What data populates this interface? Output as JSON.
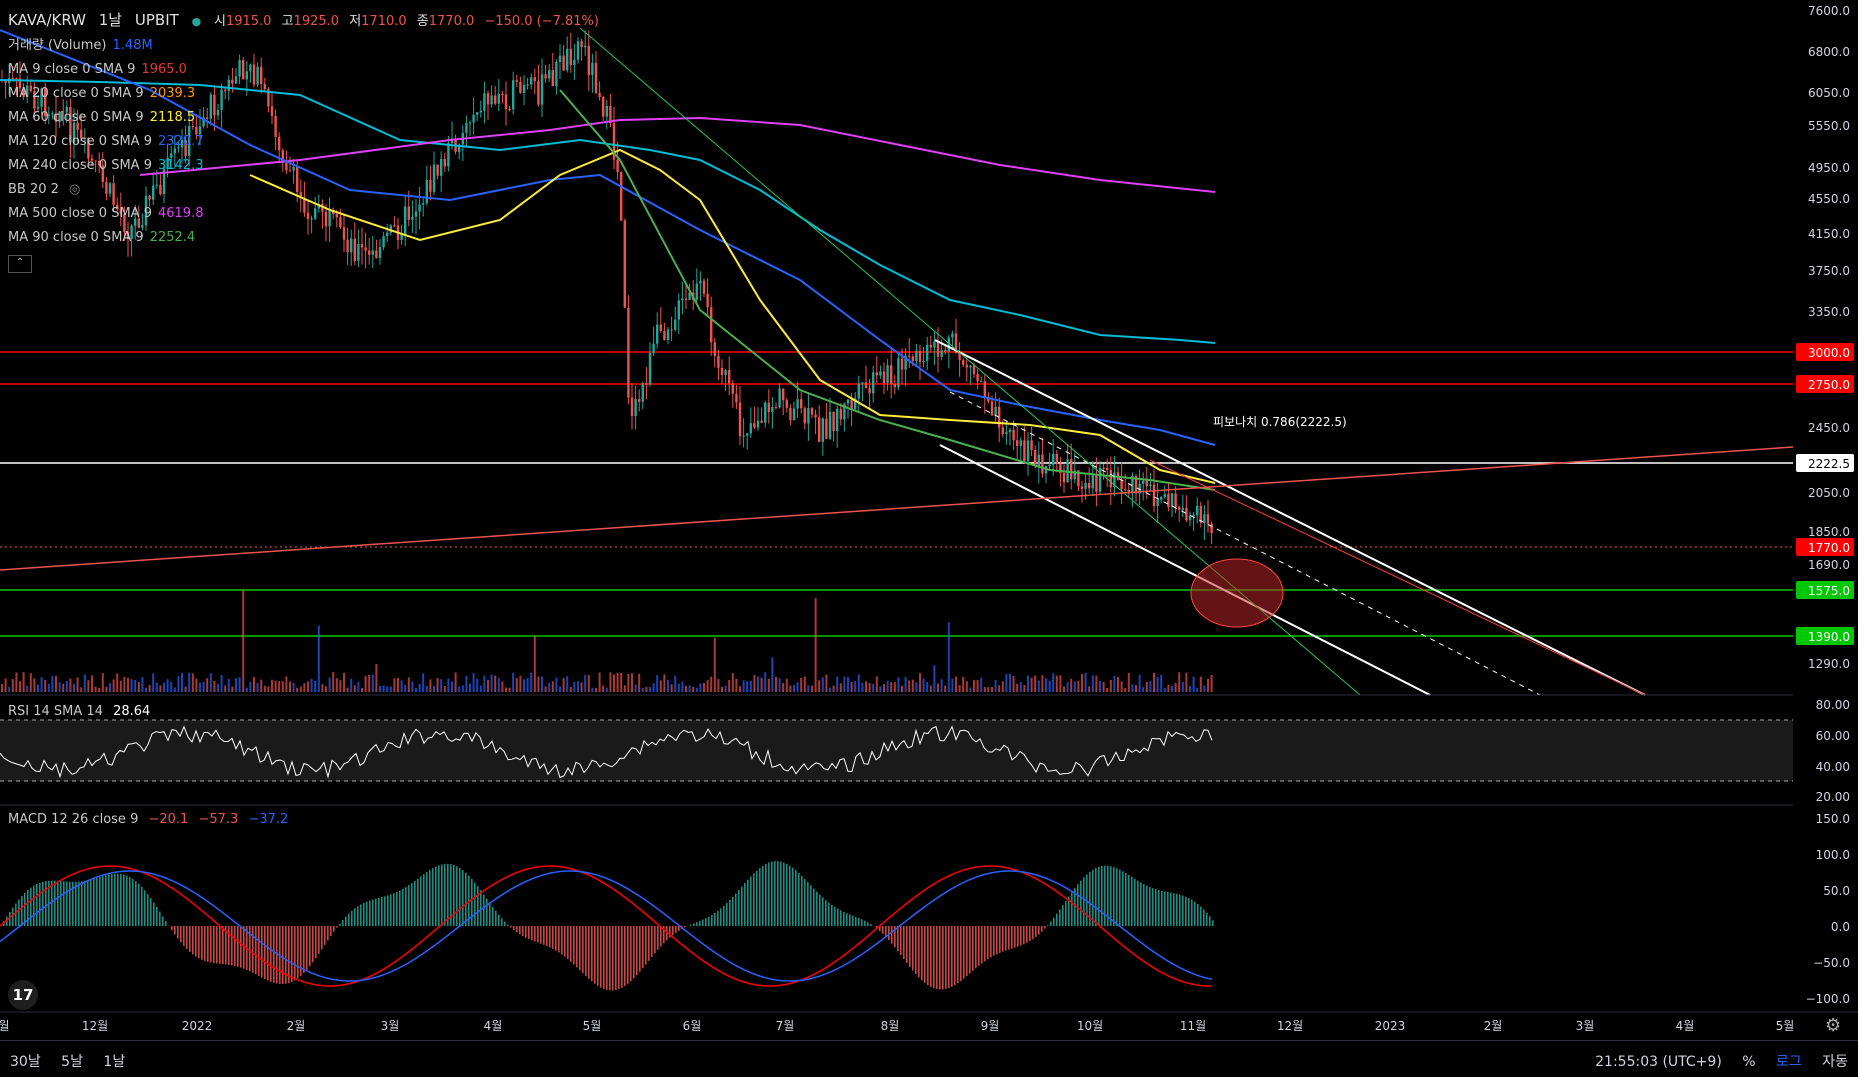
{
  "header": {
    "symbol": "KAVA/KRW",
    "interval": "1날",
    "exchange": "UPBIT",
    "ohlc_open_label": "시",
    "ohlc_open": "1915.0",
    "ohlc_high_label": "고",
    "ohlc_high": "1925.0",
    "ohlc_low_label": "저",
    "ohlc_low": "1710.0",
    "ohlc_close_label": "종",
    "ohlc_close": "1770.0",
    "ohlc_change": "−150.0 (−7.81%)"
  },
  "legend": [
    {
      "label": "거래량 (Volume)",
      "value": "1.48M",
      "color": "#2962ff"
    },
    {
      "label": "MA 9 close 0 SMA 9",
      "value": "1965.0",
      "color": "#e53935"
    },
    {
      "label": "MA 20 close 0 SMA 9",
      "value": "2039.3",
      "color": "#ff9800"
    },
    {
      "label": "MA 60 close 0 SMA 9",
      "value": "2118.5",
      "color": "#ffeb3b"
    },
    {
      "label": "MA 120 close 0 SMA 9",
      "value": "2320.7",
      "color": "#2962ff"
    },
    {
      "label": "MA 240 close 0 SMA 9",
      "value": "3142.3",
      "color": "#00bcd4"
    },
    {
      "label": "BB 20 2",
      "value": "",
      "color": "#787b86"
    },
    {
      "label": "MA 500 close 0 SMA 9",
      "value": "4619.8",
      "color": "#e040fb"
    },
    {
      "label": "MA 90 close 0 SMA 9",
      "value": "2252.4",
      "color": "#4caf50"
    }
  ],
  "collapse_label": "⌃",
  "panes": {
    "rsi_label": "RSI 14 SMA 14",
    "rsi_value": "28.64",
    "macd_label": "MACD 12 26 close 9",
    "macd_values": [
      "−20.1",
      "−57.3",
      "−37.2"
    ]
  },
  "fib_label": "피보나치 0.786(2222.5)",
  "bottombar": {
    "ranges": [
      "30날",
      "5날",
      "1날"
    ],
    "time": "21:55:03 (UTC+9)",
    "percent": "%",
    "log": "로그",
    "auto": "자동"
  },
  "colors": {
    "up": "#26a69a",
    "down": "#ef5350",
    "background": "#000000"
  },
  "chart_data": {
    "type": "candlestick",
    "price_axis_ticks": [
      "7600.0",
      "6800.0",
      "6050.0",
      "5550.0",
      "4950.0",
      "4550.0",
      "4150.0",
      "3750.0",
      "3350.0",
      "2450.0",
      "2050.0",
      "1850.0",
      "1690.0",
      "1290.0"
    ],
    "price_markers": [
      {
        "value": "3000.0",
        "color": "#ff0000"
      },
      {
        "value": "2750.0",
        "color": "#ff0000"
      },
      {
        "value": "2222.5",
        "color": "#ffffff"
      },
      {
        "value": "1770.0",
        "color": "#ff0000"
      },
      {
        "value": "1575.0",
        "color": "#00c800"
      },
      {
        "value": "1390.0",
        "color": "#00c800"
      }
    ],
    "x_axis_ticks": [
      "월",
      "12월",
      "2022",
      "2월",
      "3월",
      "4월",
      "5월",
      "6월",
      "7월",
      "8월",
      "9월",
      "10월",
      "11월",
      "12월",
      "2023",
      "2월",
      "3월",
      "4월",
      "5월"
    ],
    "rsi_ticks": [
      "80.00",
      "60.00",
      "40.00",
      "20.00"
    ],
    "macd_ticks": [
      "150.0",
      "100.0",
      "50.0",
      "0.0",
      "−50.0",
      "−100.0"
    ]
  }
}
